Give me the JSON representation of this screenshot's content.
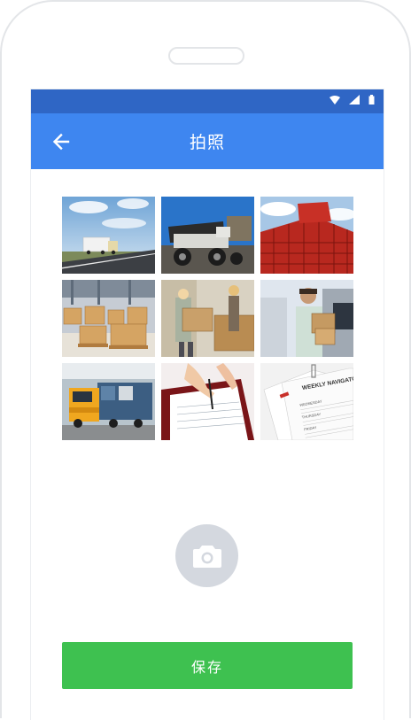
{
  "app_bar": {
    "title": "拍照",
    "back_icon": "arrow-left-icon"
  },
  "status_bar": {
    "icons": [
      "wifi-icon",
      "signal-icon",
      "battery-icon"
    ]
  },
  "photos": [
    {
      "subject": "truck-on-highway"
    },
    {
      "subject": "mining-dump-truck"
    },
    {
      "subject": "red-crate-stacks"
    },
    {
      "subject": "warehouse-pallets"
    },
    {
      "subject": "workers-carrying-boxes"
    },
    {
      "subject": "delivery-man-with-box"
    },
    {
      "subject": "yellow-truck-at-depot"
    },
    {
      "subject": "hand-signing-document"
    },
    {
      "subject": "weekly-navigator-papers"
    }
  ],
  "document_text": {
    "heading": "WEEKLY NAVIGATOR",
    "lines": [
      "WEDNESDAY",
      "THURSDAY",
      "FRIDAY"
    ]
  },
  "camera_button": {
    "icon": "camera-icon"
  },
  "save_button": {
    "label": "保存"
  },
  "colors": {
    "status_bar": "#2f66c5",
    "app_bar": "#3e86f0",
    "save_button": "#3ec150",
    "camera_button": "#d4d8df"
  }
}
